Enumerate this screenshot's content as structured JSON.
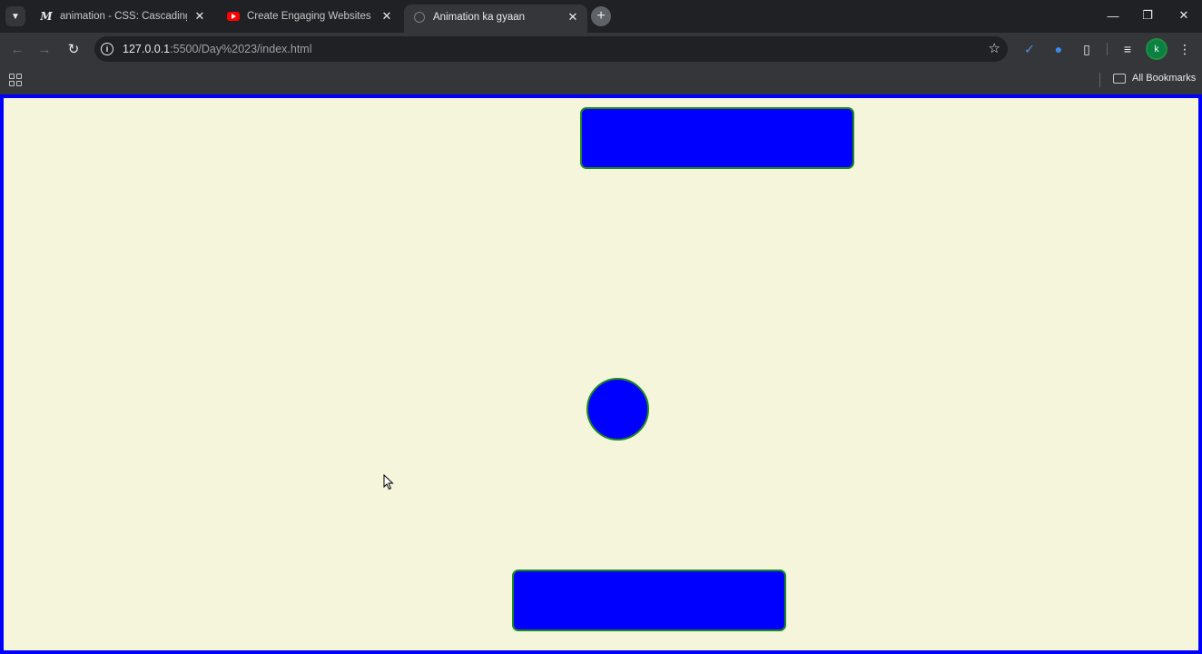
{
  "browser": {
    "tabs": [
      {
        "title": "animation - CSS: Cascading Sty",
        "favicon": "mdn-icon",
        "active": false
      },
      {
        "title": "Create Engaging Websites with",
        "favicon": "youtube-icon",
        "active": false
      },
      {
        "title": "Animation ka gyaan",
        "favicon": "globe-icon",
        "active": true
      }
    ],
    "url_host": "127.0.0.1",
    "url_rest": ":5500/Day%2023/index.html",
    "avatar_letter": "k",
    "bookmarks_label": "All Bookmarks"
  },
  "page": {
    "background_color": "#f5f5dc",
    "border_color": "#0000ff",
    "shape_fill": "#0000ff",
    "shape_border": "#1e8a1e",
    "shapes": [
      "top-rectangle",
      "circle",
      "bottom-rectangle"
    ]
  }
}
